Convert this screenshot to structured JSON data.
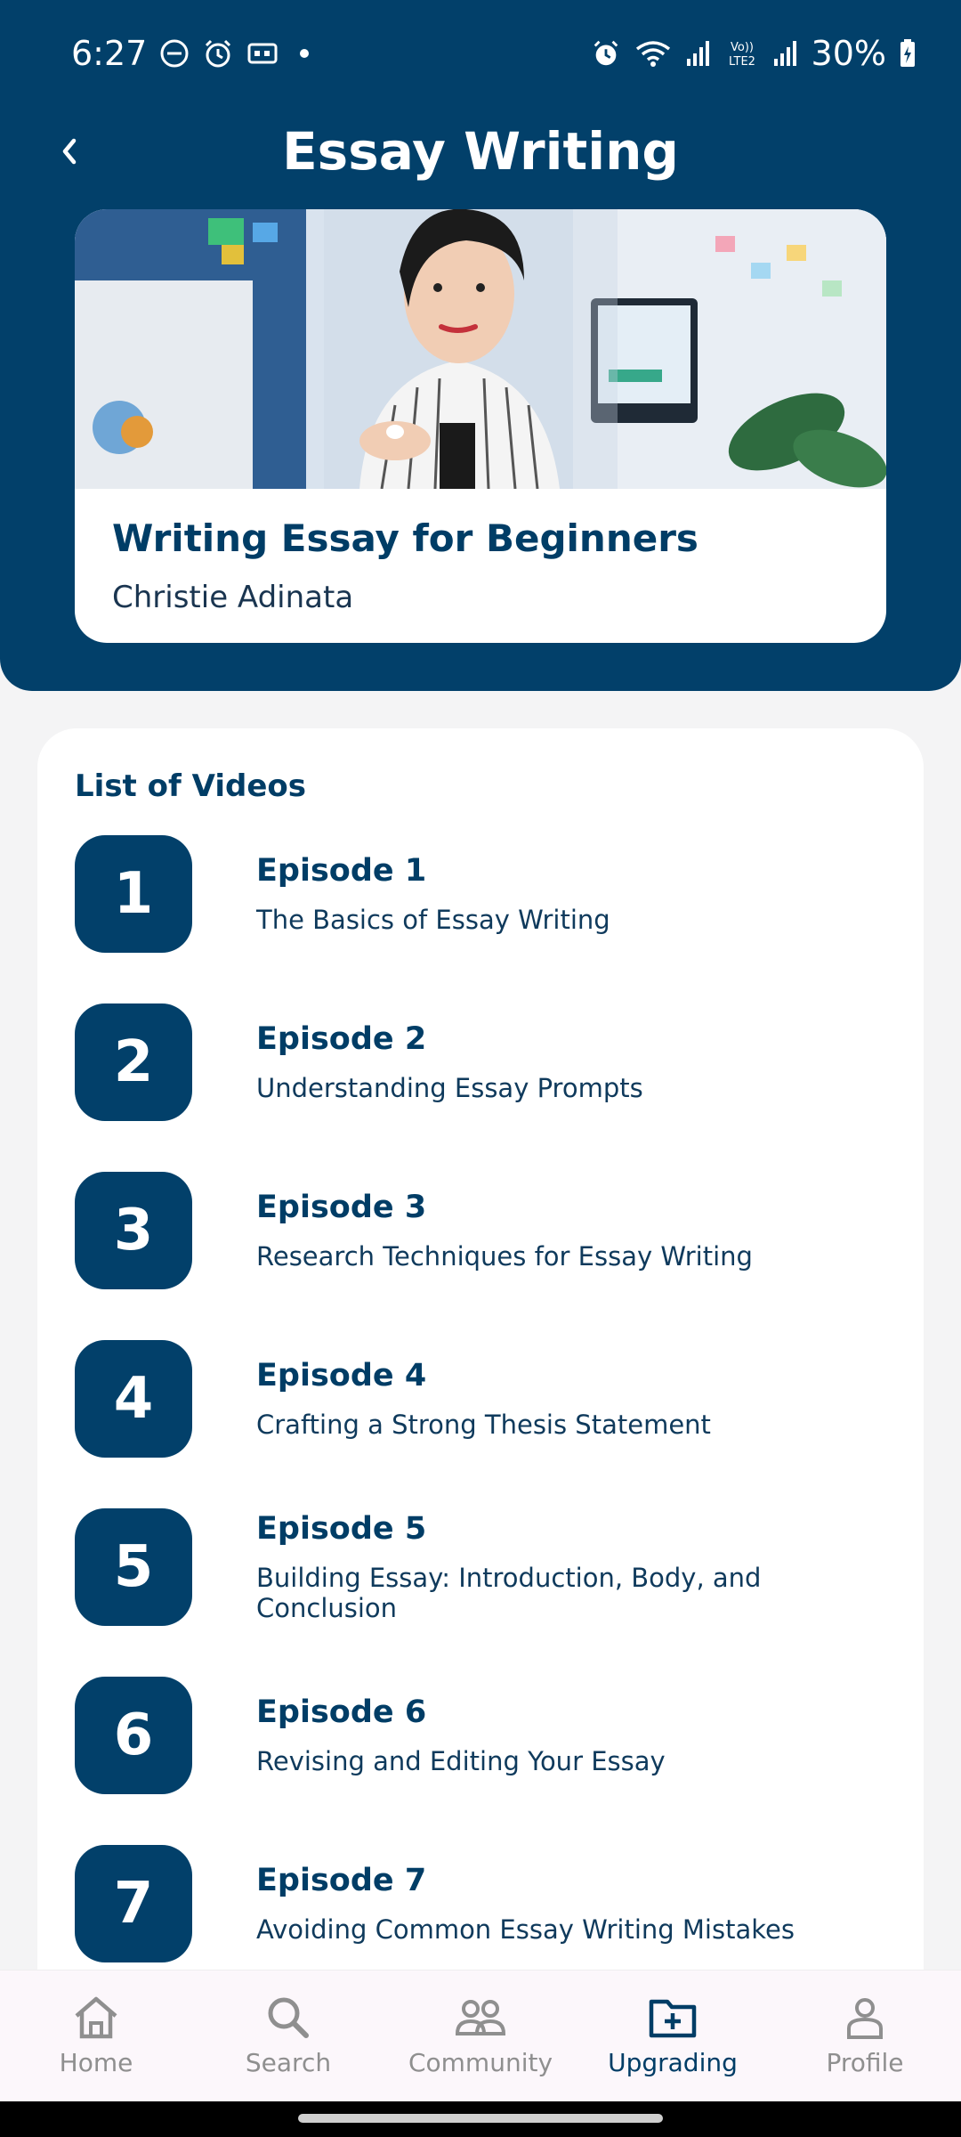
{
  "status": {
    "time": "6:27",
    "battery": "30%"
  },
  "header": {
    "title": "Essay Writing"
  },
  "course": {
    "title": "Writing Essay for Beginners",
    "author": "Christie Adinata"
  },
  "list": {
    "heading": "List of Videos",
    "episodes": [
      {
        "number": "1",
        "title": "Episode 1",
        "subtitle": "The Basics of Essay Writing"
      },
      {
        "number": "2",
        "title": "Episode 2",
        "subtitle": "Understanding Essay Prompts"
      },
      {
        "number": "3",
        "title": "Episode 3",
        "subtitle": "Research Techniques for Essay Writing"
      },
      {
        "number": "4",
        "title": "Episode 4",
        "subtitle": "Crafting a Strong Thesis Statement"
      },
      {
        "number": "5",
        "title": "Episode 5",
        "subtitle": "Building Essay: Introduction, Body, and Conclusion"
      },
      {
        "number": "6",
        "title": "Episode 6",
        "subtitle": "Revising and Editing Your Essay"
      },
      {
        "number": "7",
        "title": "Episode 7",
        "subtitle": "Avoiding Common Essay Writing Mistakes"
      }
    ]
  },
  "nav": {
    "home": "Home",
    "search": "Search",
    "community": "Community",
    "upgrading": "Upgrading",
    "profile": "Profile",
    "active": "upgrading"
  },
  "colors": {
    "primary": "#02406a",
    "text_dark": "#003d66",
    "inactive": "#8f8f8f"
  }
}
